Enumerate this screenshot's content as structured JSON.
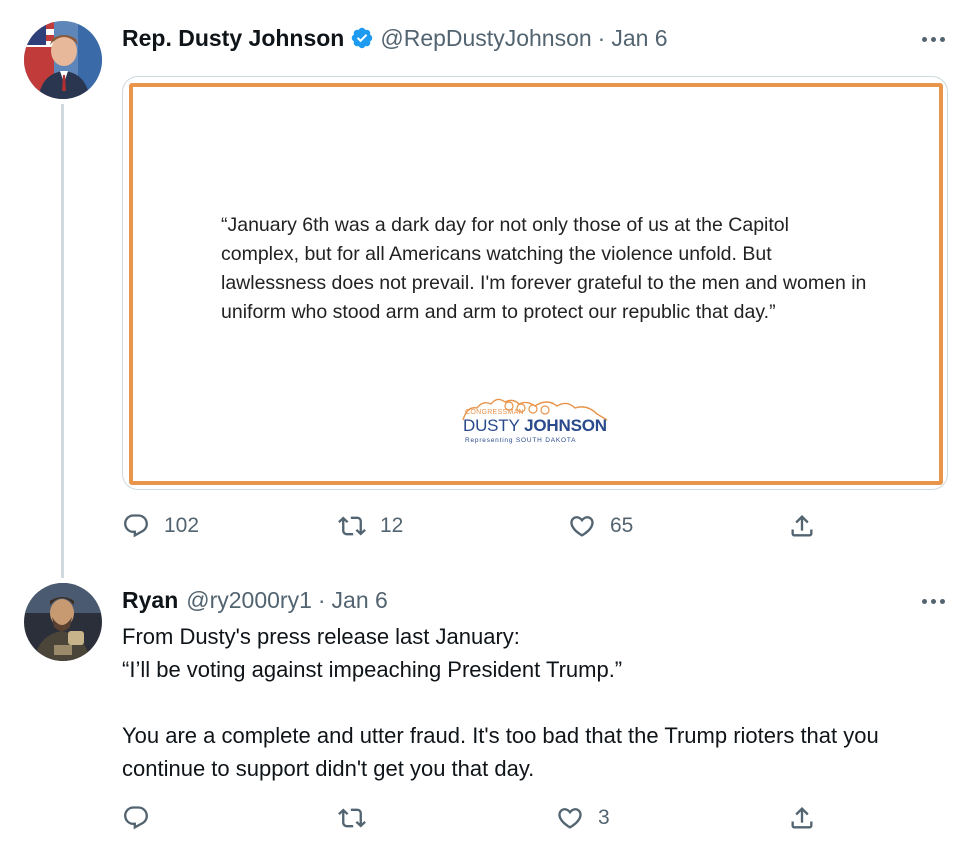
{
  "tweets": [
    {
      "name": "Rep. Dusty Johnson",
      "verified": true,
      "handle": "@RepDustyJohnson",
      "dot": "·",
      "date": "Jan 6",
      "media": {
        "quote": "“January 6th was a dark day for not only those of us at the Capitol complex, but for all Americans watching the violence unfold. But lawlessness does not prevail. I'm forever grateful to the men and women in uniform who stood arm and arm to protect our republic that day.”",
        "logo_top": "CONGRESSMAN",
        "logo_first": "DUSTY",
        "logo_last": "JOHNSON",
        "logo_sub": "Representing SOUTH DAKOTA"
      },
      "replies": "102",
      "retweets": "12",
      "likes": "65"
    },
    {
      "name": "Ryan",
      "handle": "@ry2000ry1",
      "dot": "·",
      "date": "Jan 6",
      "line1": "From Dusty's press release last January:",
      "line2": "“I’ll be voting against impeaching President Trump.”",
      "line3": "You are a complete and utter fraud.  It's too bad that the Trump rioters that you continue to support didn't get you that day.",
      "replies": "",
      "retweets": "",
      "likes": "3"
    }
  ],
  "colors": {
    "accent_blue": "#1d9bf0",
    "frame_orange": "#e8944a",
    "muted": "#536471"
  },
  "icons": [
    "reply-icon",
    "retweet-icon",
    "like-icon",
    "share-icon",
    "more-icon",
    "verified-icon"
  ]
}
